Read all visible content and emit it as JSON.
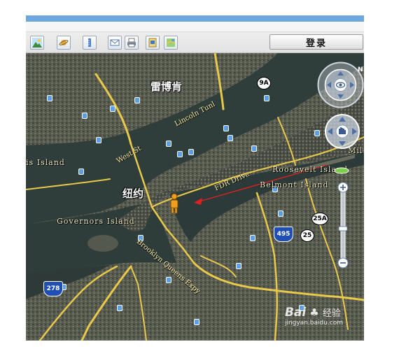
{
  "toolbar": {
    "buttons": [
      {
        "icon": "sunlight-landscape-icon"
      },
      {
        "icon": "planet-icon"
      },
      {
        "icon": "ruler-icon"
      },
      {
        "icon": "email-icon"
      },
      {
        "icon": "print-icon"
      },
      {
        "icon": "save-image-icon"
      },
      {
        "icon": "map-view-icon"
      }
    ],
    "login_label": "登录"
  },
  "map": {
    "labels": {
      "museum": "雷博肯",
      "city": "纽约",
      "ellis_island": "is Island",
      "governors_island": "Governors Island",
      "roosevelt_island": "Roosevelt Island",
      "belmont_island": "Belmont Island",
      "fdr_drive": "FDR Drive",
      "west_st": "West St",
      "brooklyn_queens_expy": "Brooklyn Queens Expy",
      "road_upper": "Lincoln Tunl",
      "right_edge": "Mil"
    },
    "shields": {
      "exit_9a": "9A",
      "route_25a": "25A",
      "route_25": "25",
      "interstate_495": "495",
      "interstate_278": "278"
    },
    "watermark_brand": "Bai",
    "watermark_cn": "经验",
    "watermark_url": "jingyan.baidu.com"
  },
  "colors": {
    "titlebar": "#6fa8dc",
    "water": "#2e3d3a",
    "road": "#e8c94a",
    "arrow": "#e02020",
    "pegman": "#f0a020"
  }
}
